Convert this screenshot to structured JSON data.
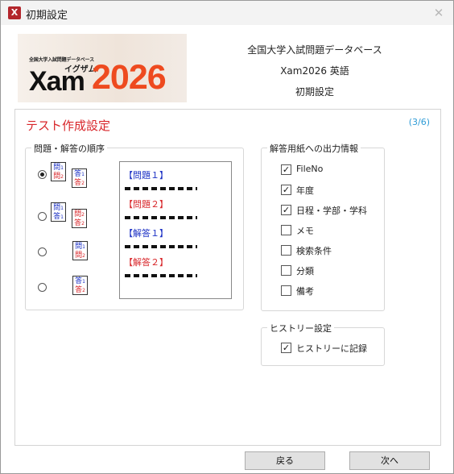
{
  "window": {
    "title": "初期設定",
    "icon_label": "X"
  },
  "logo": {
    "subtitle": "全国大学入試問題データベース",
    "kana": "イグザム",
    "brand": "Xam",
    "year": "2026"
  },
  "header": {
    "line1": "全国大学入試問題データベース",
    "line2": "Xam2026 英語",
    "line3": "初期設定"
  },
  "main": {
    "section_title": "テスト作成設定",
    "page_indicator": "(3/6)"
  },
  "order_group": {
    "label": "問題・解答の順序",
    "card_text": {
      "mon": "問",
      "ans": "答",
      "one": "1",
      "two": "2"
    },
    "preview": {
      "items": [
        {
          "label": "【問題１】",
          "color": "#1a2fc4"
        },
        {
          "label": "【問題２】",
          "color": "#d8262a"
        },
        {
          "label": "【解答１】",
          "color": "#1a2fc4"
        },
        {
          "label": "【解答２】",
          "color": "#d8262a"
        }
      ]
    }
  },
  "output_group": {
    "label": "解答用紙への出力情報",
    "items": [
      {
        "label": "FileNo",
        "checked": true
      },
      {
        "label": "年度",
        "checked": true
      },
      {
        "label": "日程・学部・学科",
        "checked": true
      },
      {
        "label": "メモ",
        "checked": false
      },
      {
        "label": "検索条件",
        "checked": false
      },
      {
        "label": "分類",
        "checked": false
      },
      {
        "label": "備考",
        "checked": false
      }
    ]
  },
  "history_group": {
    "label": "ヒストリー設定",
    "item": {
      "label": "ヒストリーに記録",
      "checked": true
    }
  },
  "buttons": {
    "back": "戻る",
    "next": "次へ"
  },
  "check_glyph": "✓",
  "colors": {
    "accent_red": "#d8262a",
    "blue": "#1a2fc4",
    "page_indicator": "#2e9bd6",
    "logo_orange": "#ee4a1f"
  }
}
